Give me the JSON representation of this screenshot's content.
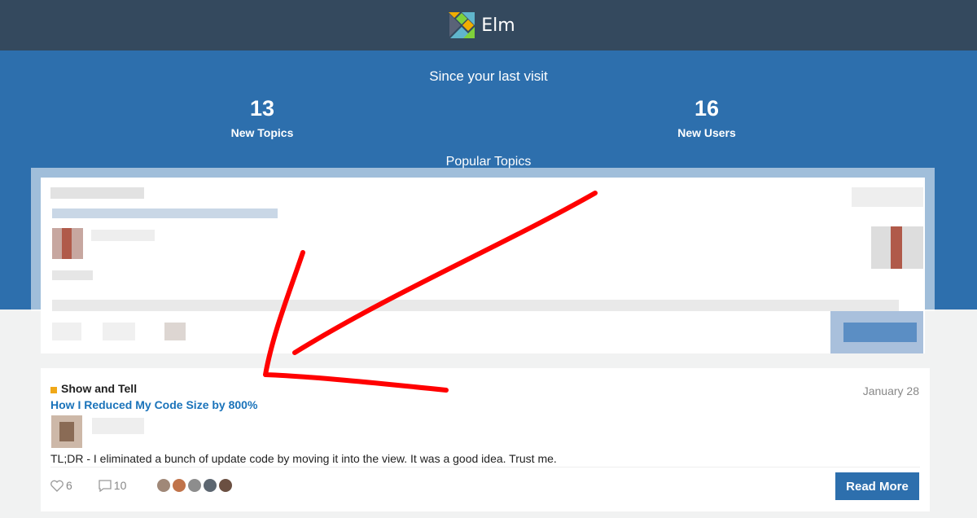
{
  "header": {
    "brand": "Elm",
    "logo_icon": "elm-tangram-logo"
  },
  "hero": {
    "since_text": "Since your last visit",
    "stats": [
      {
        "value": "13",
        "label": "New Topics"
      },
      {
        "value": "16",
        "label": "New Users"
      }
    ],
    "popular_heading": "Popular Topics"
  },
  "topic": {
    "category": "Show and Tell",
    "category_color": "#f0a818",
    "date": "January 28",
    "title": "How I Reduced My Code Size by 800%",
    "excerpt": "TL;DR - I eliminated a bunch of update code by moving it into the view. It was a good idea. Trust me.",
    "likes": "6",
    "replies": "10",
    "read_more": "Read More"
  },
  "colors": {
    "topbar": "#34495e",
    "hero": "#2d6fad",
    "link": "#1a73ba",
    "annotation": "#ff0000"
  }
}
